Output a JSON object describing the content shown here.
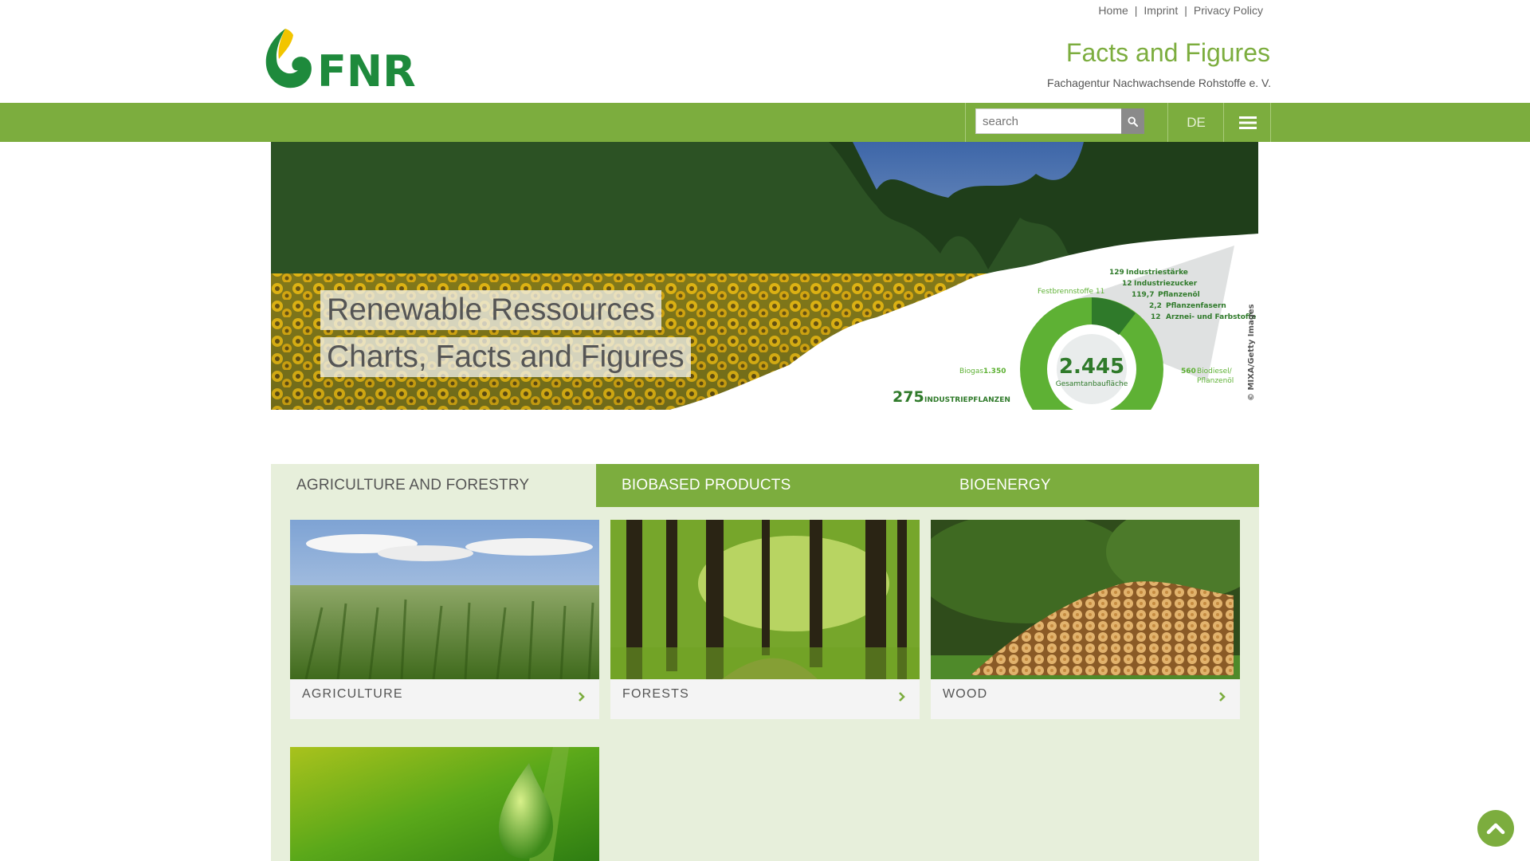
{
  "top_links": [
    {
      "label": "Home"
    },
    {
      "label": "Imprint"
    },
    {
      "label": "Privacy Policy"
    }
  ],
  "top_links_separator": "|",
  "brand": {
    "logo_text": "FNR",
    "title": "Facts and Figures",
    "subtitle": "Fachagentur Nachwachsende Rohstoffe e. V."
  },
  "nav": {
    "search_placeholder": "search",
    "language": "DE"
  },
  "hero": {
    "caption_line1": "Renewable Ressources",
    "caption_line2": "Charts, Facts and Figures",
    "credit": "© MIXA/Getty Images",
    "infographic": {
      "total": "2.445",
      "total_label": "Gesamtanbaufläche",
      "industrial_count": "275",
      "industrial_label": "INDUSTRIEPFLANZEN",
      "items": [
        {
          "value": "129",
          "label": "Industriestärke"
        },
        {
          "value": "12",
          "label": "Industriezucker"
        },
        {
          "value": "119,7",
          "label": "Pflanzenöl"
        },
        {
          "value": "2,2",
          "label": "Pflanzenfasern"
        },
        {
          "value": "12",
          "label": "Arznei- und Farbstoffe"
        }
      ],
      "festbrennstoffe": "Festbrennstoffe 11",
      "biogas_label": "Biogas",
      "biogas_value": "1.350",
      "biodiesel_value": "560",
      "biodiesel_label": "Biodiesel/",
      "biodiesel_label2": "Pflanzenöl"
    }
  },
  "tabs": [
    {
      "label": "AGRICULTURE AND FORESTRY",
      "active": true
    },
    {
      "label": "BIOBASED PRODUCTS",
      "active": false
    },
    {
      "label": "BIOENERGY",
      "active": false
    }
  ],
  "cards": [
    {
      "label": "AGRICULTURE"
    },
    {
      "label": "FORESTS"
    },
    {
      "label": "WOOD"
    }
  ],
  "colors": {
    "brand_green": "#7cad3e",
    "panel_bg": "#e7efdb",
    "logo_yellow": "#f2c500",
    "logo_green": "#1e8a3c"
  }
}
